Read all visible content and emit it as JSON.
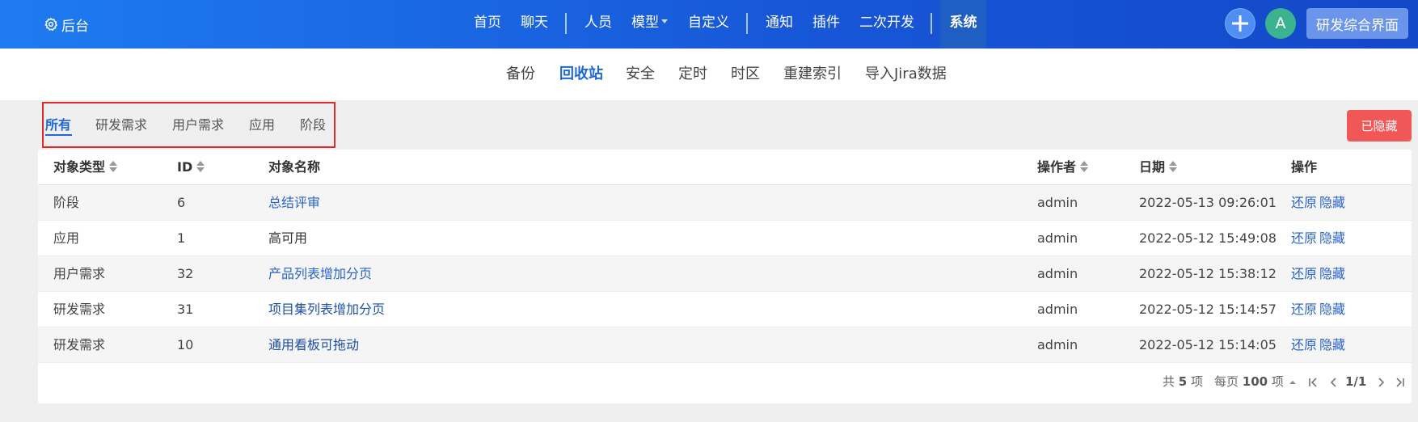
{
  "topbar": {
    "brand": "后台",
    "nav": [
      "首页",
      "聊天",
      "人员",
      "模型",
      "自定义",
      "通知",
      "插件",
      "二次开发",
      "系统"
    ],
    "avatar_letter": "A",
    "dev_button": "研发综合界面"
  },
  "subnav": [
    "备份",
    "回收站",
    "安全",
    "定时",
    "时区",
    "重建索引",
    "导入Jira数据"
  ],
  "tabs": [
    "所有",
    "研发需求",
    "用户需求",
    "应用",
    "阶段"
  ],
  "hidden_button": "已隐藏",
  "table": {
    "headers": [
      "对象类型",
      "ID",
      "对象名称",
      "操作者",
      "日期",
      "操作"
    ],
    "rows": [
      {
        "type": "阶段",
        "id": "6",
        "name": "总结评审",
        "operator": "admin",
        "date": "2022-05-13 09:26:01"
      },
      {
        "type": "应用",
        "id": "1",
        "name": "高可用",
        "operator": "admin",
        "date": "2022-05-12 15:49:08"
      },
      {
        "type": "用户需求",
        "id": "32",
        "name": "产品列表增加分页",
        "operator": "admin",
        "date": "2022-05-12 15:38:12"
      },
      {
        "type": "研发需求",
        "id": "31",
        "name": "项目集列表增加分页",
        "operator": "admin",
        "date": "2022-05-12 15:14:57"
      },
      {
        "type": "研发需求",
        "id": "10",
        "name": "通用看板可拖动",
        "operator": "admin",
        "date": "2022-05-12 15:14:05"
      }
    ],
    "action_restore": "还原",
    "action_hide": "隐藏"
  },
  "pager": {
    "total_prefix": "共",
    "total": "5",
    "total_suffix": "项",
    "per_page_prefix": "每页",
    "per_page": "100",
    "per_page_suffix": "项",
    "page": "1/1"
  }
}
